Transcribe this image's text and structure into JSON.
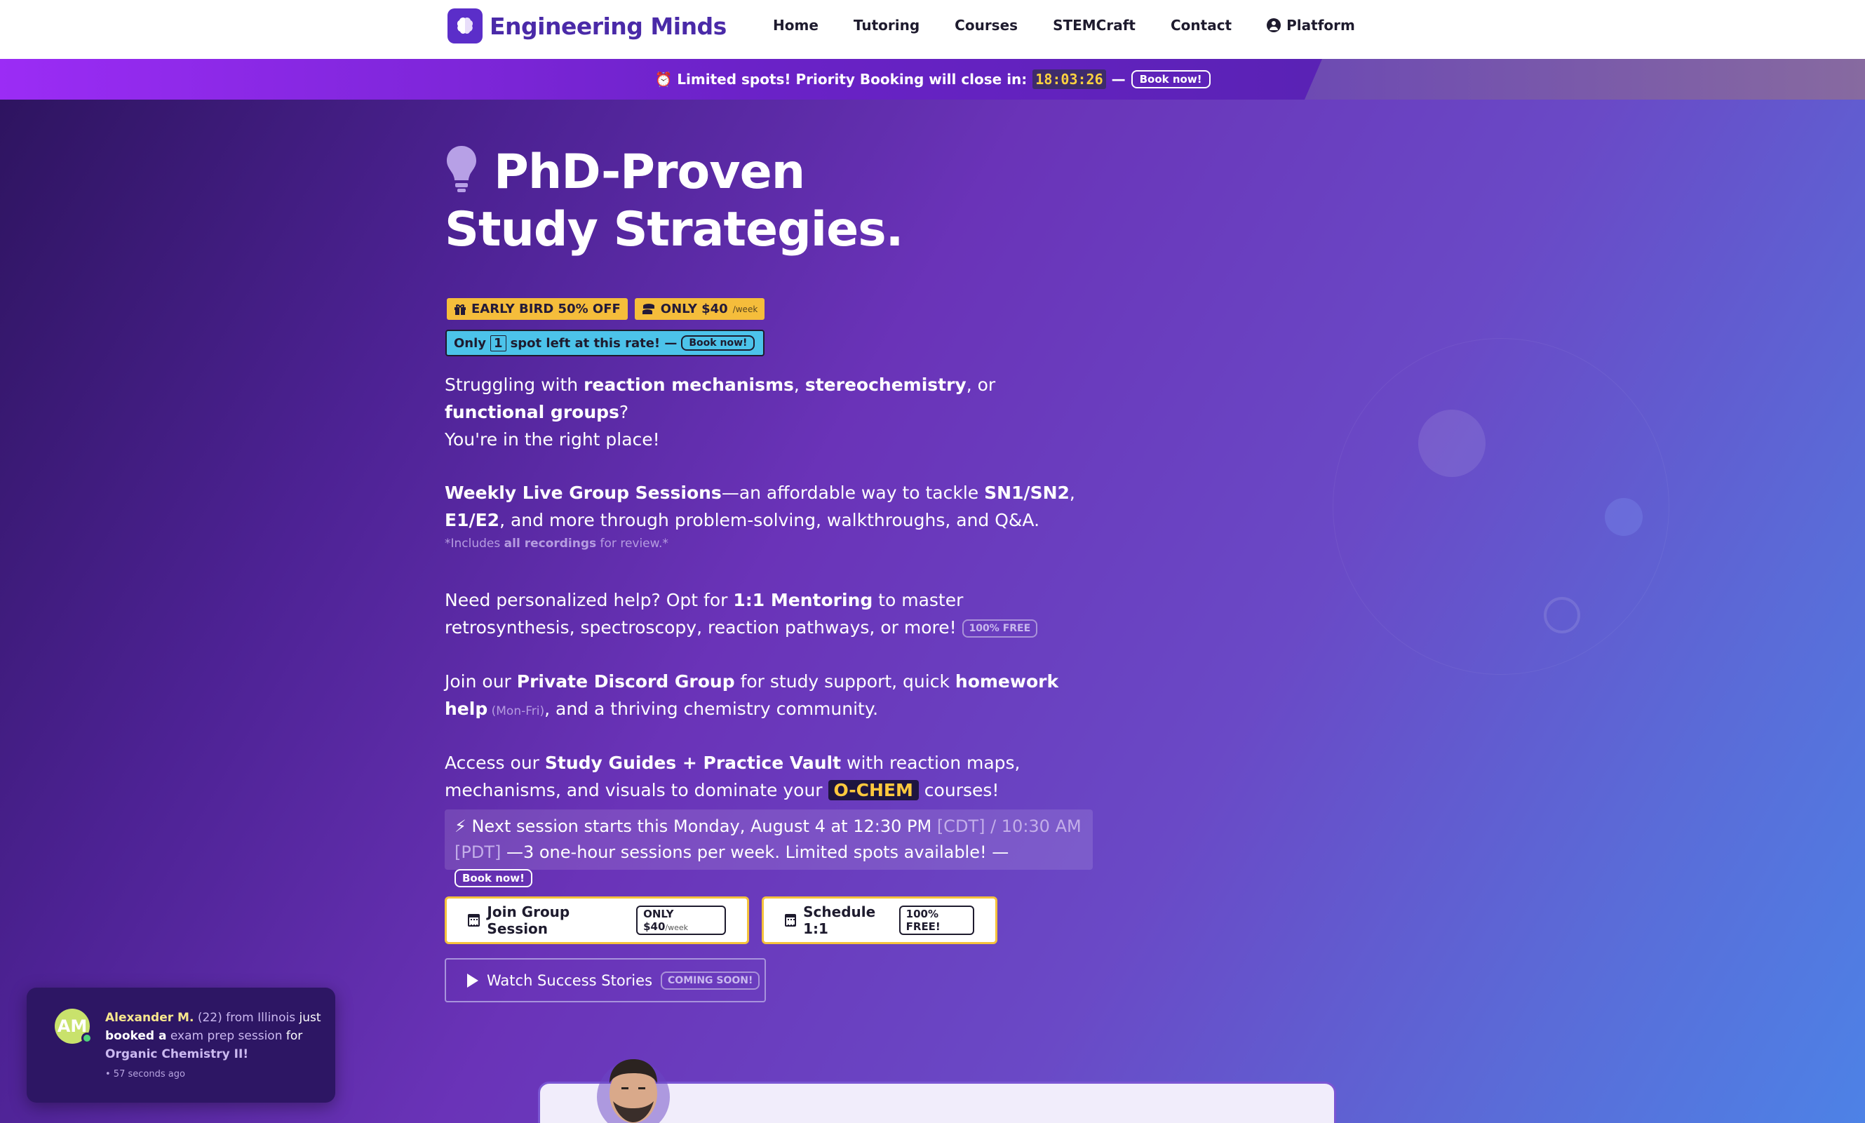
{
  "header": {
    "logo_text": "Engineering Minds",
    "nav": [
      "Home",
      "Tutoring",
      "Courses",
      "STEMCraft",
      "Contact",
      "Platform"
    ]
  },
  "promo": {
    "prefix": "⏰ Limited spots! Priority Booking will close in:",
    "timer": "18:03:26",
    "dash": "—",
    "cta": "Book now!"
  },
  "hero": {
    "headline_line1": "PhD-Proven",
    "headline_line2": "Study Strategies.",
    "badge_early": "EARLY BIRD 50% OFF",
    "badge_price": "ONLY $40",
    "badge_price_unit": "/week",
    "spots_prefix": "Only",
    "spots_count": "1",
    "spots_suffix": "spot left at this rate! —",
    "spots_cta": "Book now!"
  },
  "paragraphs": {
    "p1_a": "Struggling with ",
    "p1_b": "reaction mechanisms",
    "p1_c": ", ",
    "p1_d": "stereochemistry",
    "p1_e": ", or ",
    "p1_f": "functional groups",
    "p1_g": "?",
    "p1_line2": "You're in the right place!",
    "p2_a": "Weekly Live Group Sessions",
    "p2_b": "—an affordable way to tackle ",
    "p2_c": "SN1/SN2",
    "p2_d": ", ",
    "p2_e": "E1/E2",
    "p2_f": ", and more through problem-solving, walkthroughs, and Q&A.",
    "p2_note_a": "*Includes ",
    "p2_note_b": "all recordings",
    "p2_note_c": " for review.*",
    "p3_a": "Need personalized help? Opt for ",
    "p3_b": "1:1 Mentoring",
    "p3_c": " to master retrosynthesis, spectroscopy, reaction pathways, or more! ",
    "p3_tag": "100% FREE",
    "p4_a": "Join our ",
    "p4_b": "Private Discord Group",
    "p4_c": " for study support, quick ",
    "p4_d": "homework help",
    "p4_e": " (Mon-Fri)",
    "p4_f": ", and a thriving chemistry community.",
    "p5_a": "Access our ",
    "p5_b": "Study Guides + Practice Vault",
    "p5_c": " with reaction maps, mechanisms, and visuals to dominate your ",
    "p5_tag": "O-CHEM",
    "p5_d": " courses!"
  },
  "session": {
    "a": "⚡ Next session starts this Monday, August 4 at 12:30 PM",
    "b": " [CDT] / 10:30 AM [PDT] ",
    "c": "—3 one-hour sessions per week. Limited spots available! — ",
    "cta": "Book now!"
  },
  "buttons": {
    "group_label": "Join Group Session",
    "group_tag": "ONLY $40",
    "group_tag_unit": "/week",
    "schedule_label": "Schedule 1:1",
    "schedule_tag": "100% FREE!",
    "watch_label": "Watch Success Stories",
    "watch_tag": "COMING SOON!"
  },
  "toast": {
    "initials": "AM",
    "name": "Alexander M.",
    "age": "(22) from",
    "place": "Illinois",
    "just": "just",
    "booked": "booked a",
    "service": "exam prep session",
    "for": "for",
    "course": "Organic Chemistry II!",
    "time": "• 57 seconds ago"
  },
  "colors": {
    "brand": "#5b2ec9",
    "accent_yellow": "#f5bd3b",
    "accent_cyan": "#4cc3ea"
  },
  "icons": [
    "brain-icon",
    "alarm-clock-icon",
    "lightbulb-icon",
    "gift-icon",
    "coins-icon",
    "calendar-icon",
    "play-icon",
    "user-circle-icon"
  ]
}
